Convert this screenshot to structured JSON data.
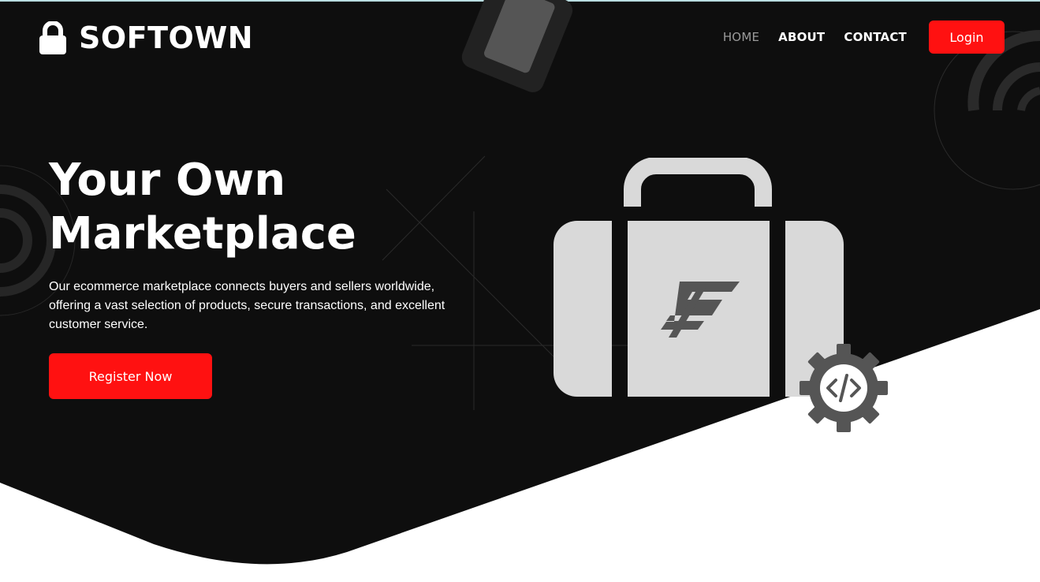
{
  "brand": {
    "name": "SOFTOWN",
    "icon": "lock-icon"
  },
  "nav": {
    "items": [
      {
        "label": "HOME",
        "active": true
      },
      {
        "label": "ABOUT",
        "active": false
      },
      {
        "label": "CONTACT",
        "active": false
      }
    ],
    "login_label": "Login"
  },
  "hero": {
    "title_line1": "Your Own",
    "title_line2": "Marketplace",
    "description": "Our ecommerce marketplace connects buyers and sellers worldwide, offering a vast selection of products, secure transactions, and excellent customer service.",
    "cta_label": "Register Now",
    "illustration": {
      "main": "briefcase-icon",
      "badge": "code-gear-icon",
      "emblem": "softown-emblem"
    }
  },
  "colors": {
    "background": "#0e0e0e",
    "accent": "#ff1111",
    "text": "#ffffff",
    "muted_nav": "#9a9a9a",
    "illustration_light": "#d9d9d9",
    "illustration_dark": "#555555"
  }
}
